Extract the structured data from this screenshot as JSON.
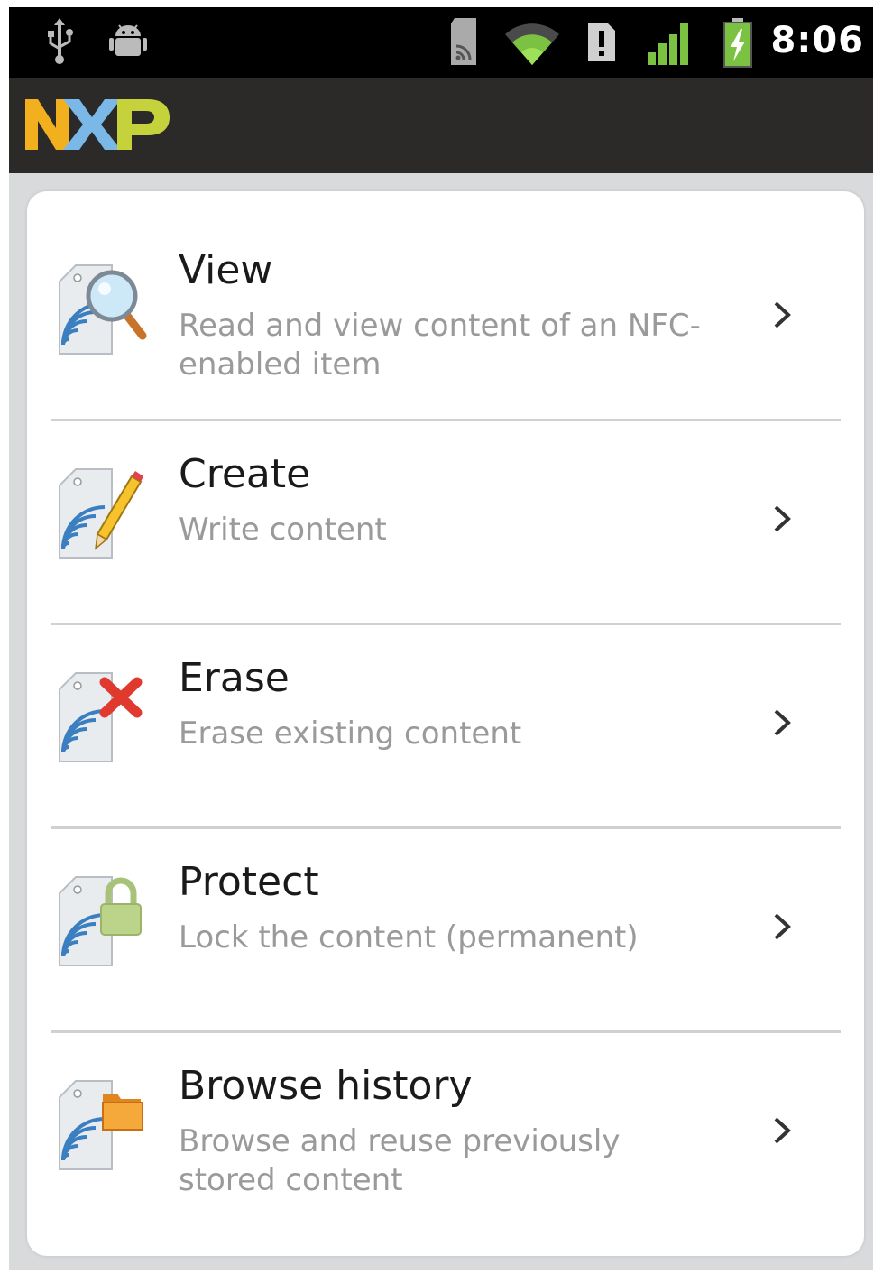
{
  "status_bar": {
    "time": "8:06",
    "icons": [
      "usb-icon",
      "android-debug-icon",
      "sd-card-nfc-icon",
      "wifi-icon",
      "notification-icon",
      "signal-bars-icon",
      "battery-charging-icon"
    ]
  },
  "app_bar": {
    "logo_text": "NXP",
    "logo_colors": [
      "#f2b01e",
      "#7ab8e8",
      "#c5d23c"
    ]
  },
  "menu": {
    "items": [
      {
        "title": "View",
        "description": "Read and view content of an NFC-enabled item",
        "icon": "tag-magnifier-icon"
      },
      {
        "title": "Create",
        "description": "Write content",
        "icon": "tag-pencil-icon"
      },
      {
        "title": "Erase",
        "description": "Erase existing content",
        "icon": "tag-red-x-icon"
      },
      {
        "title": "Protect",
        "description": "Lock the content (permanent)",
        "icon": "tag-lock-icon"
      },
      {
        "title": "Browse history",
        "description": "Browse and reuse previously stored content",
        "icon": "tag-folder-icon"
      }
    ]
  },
  "colors": {
    "status_bar": "#000000",
    "app_bar": "#2b2a28",
    "background": "#d9dadc",
    "card": "#ffffff",
    "title_text": "#1a1a1a",
    "description_text": "#9a9a9a",
    "nfc_waves": "#3c7fc0"
  }
}
